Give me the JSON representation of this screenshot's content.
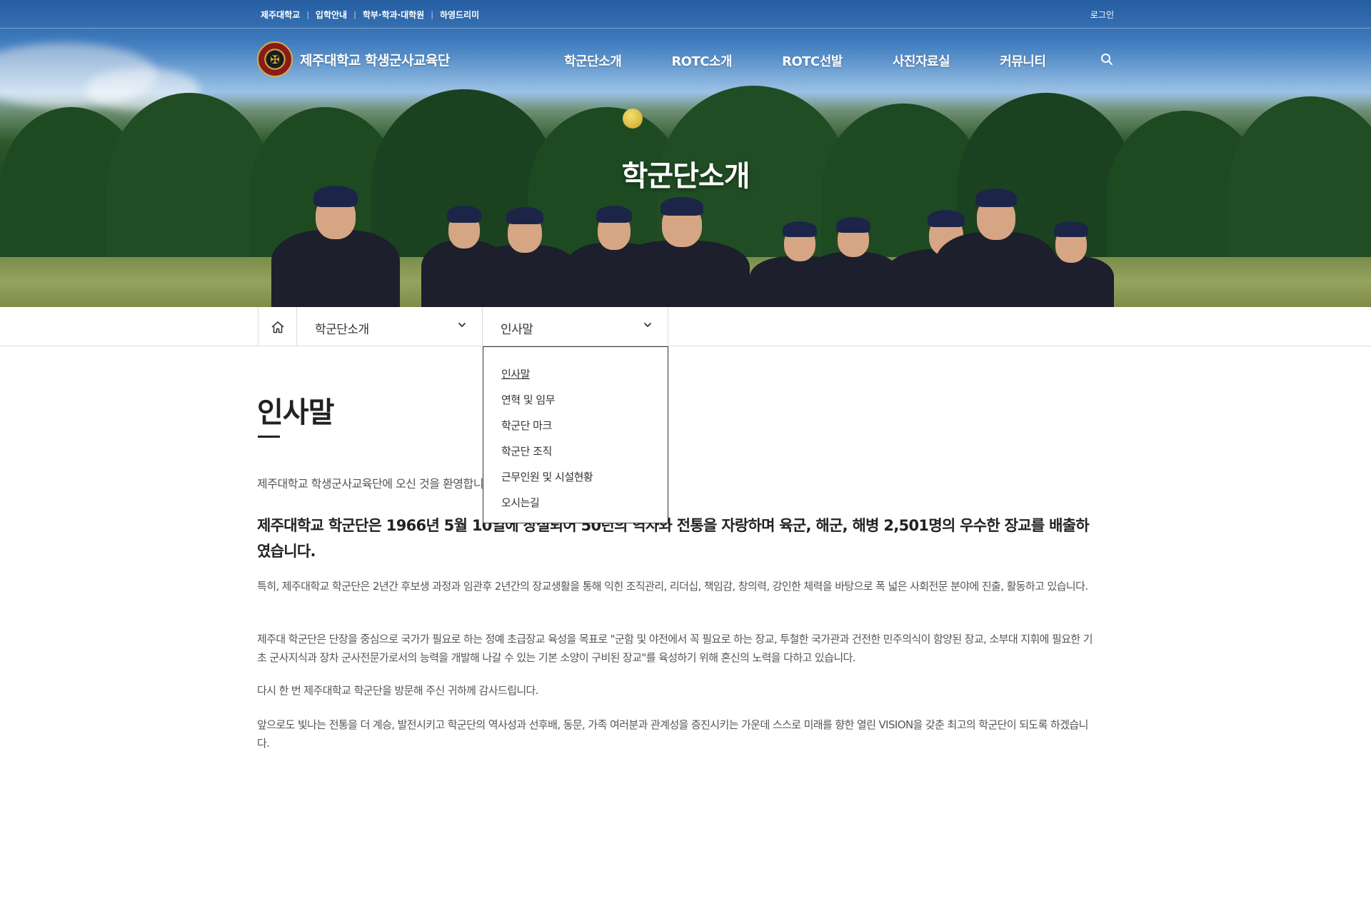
{
  "util_links": [
    "제주대학교",
    "입학안내",
    "학부·학과·대학원",
    "하영드리미"
  ],
  "login": "로그인",
  "logo": {
    "text": "제주대학교 학생군사교육단"
  },
  "gnb": [
    "학군단소개",
    "ROTC소개",
    "ROTC선발",
    "사진자료실",
    "커뮤니티"
  ],
  "icons": {
    "search": "search-icon",
    "home": "home-icon",
    "chevron": "chevron-down-icon"
  },
  "hero": {
    "title": "학군단소개"
  },
  "location": {
    "depth1": "학군단소개",
    "depth2": "인사말",
    "submenu": [
      "인사말",
      "연혁 및 임무",
      "학군단 마크",
      "학군단 조직",
      "근무인원 및 시설현황",
      "오시는길"
    ]
  },
  "content": {
    "title": "인사말",
    "intro": "제주대학교 학생군사교육단에 오신 것을 환영합니다.",
    "lead": "제주대학교 학군단은 1966년 5월 10일에 창설되어 50년의 역사와 전통을 자랑하며 육군, 해군, 해병 2,501명의 우수한 장교를 배출하였습니다.",
    "paragraphs": [
      "특히, 제주대학교 학군단은 2년간 후보생 과정과 임관후 2년간의 장교생활을 통해 익힌 조직관리, 리더십, 책임감, 창의력, 강인한 체력을 바탕으로 폭 넓은 사회전문 분야에 진출, 활동하고 있습니다.",
      "제주대 학군단은 단장을 중심으로 국가가 필요로 하는 정예 초급장교 육성을 목표로 \"군함 및 야전에서 꼭 필요로 하는 장교, 투철한 국가관과 건전한 민주의식이 함양된 장교, 소부대 지휘에 필요한 기초 군사지식과 장차 군사전문가로서의 능력을 개발해 나갈 수 있는 기본 소양이 구비된 장교\"를 육성하기 위해 혼신의 노력을 다하고 있습니다.",
      "다시 한 번 제주대학교 학군단을 방문해 주신 귀하께 감사드립니다.",
      "앞으로도 빛나는 전통을 더 계승, 발전시키고 학군단의 역사성과 선후배, 동문, 가족 여러분과 관계성을 증진시키는 가운데 스스로 미래를 향한 열린 VISION을 갖춘 최고의 학군단이 되도록 하겠습니다."
    ]
  },
  "colors": {
    "text": "#222222",
    "body_text": "#555555",
    "border": "#dcdcdc"
  }
}
